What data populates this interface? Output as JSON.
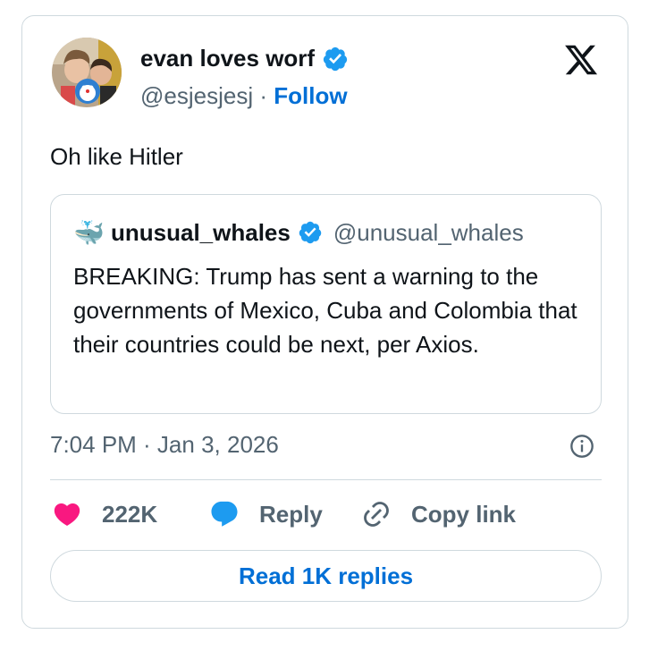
{
  "author": {
    "display_name": "evan loves worf",
    "handle": "@esjesjesj",
    "separator": "·",
    "follow_label": "Follow",
    "verified": true
  },
  "tweet": {
    "text": "Oh like Hitler",
    "timestamp": "7:04 PM · Jan 3, 2026"
  },
  "quoted": {
    "avatar_emoji": "🐳",
    "name": "unusual_whales",
    "handle": "@unusual_whales",
    "verified": true,
    "text": "BREAKING: Trump has sent a warning to the governments of Mexico, Cuba and Colombia that their countries could be next, per Axios."
  },
  "actions": {
    "like_count": "222K",
    "reply_label": "Reply",
    "copy_label": "Copy link",
    "read_replies_label": "Read 1K replies"
  },
  "colors": {
    "link": "#006fd6",
    "verified": "#1d9bf0",
    "like": "#f91880",
    "reply": "#1d9bf0",
    "secondary_text": "#536471",
    "border": "#cfd9de"
  },
  "icons": [
    "x-logo-icon",
    "verified-badge-icon",
    "info-icon",
    "heart-icon",
    "reply-bubble-icon",
    "link-icon"
  ]
}
